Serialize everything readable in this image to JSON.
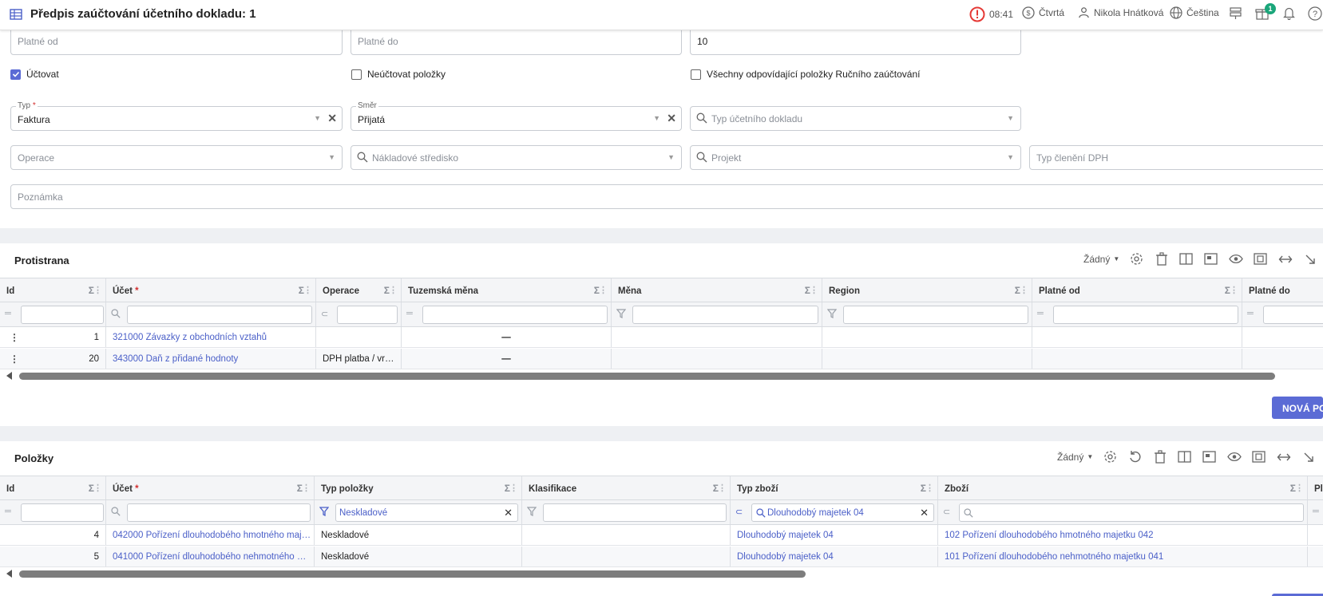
{
  "header": {
    "title": "Předpis zaúčtování účetního dokladu: 1",
    "time": "08:41",
    "day": "Čtvrtá",
    "user": "Nikola Hnátková",
    "language": "Čeština",
    "notification_count": "1"
  },
  "form": {
    "platne_od_placeholder": "Platné od",
    "platne_do_placeholder": "Platné do",
    "poradi_value": "10",
    "uctovat_label": "Účtovat",
    "uctovat_checked": true,
    "neuctovat_label": "Neúčtovat položky",
    "vsechny_label": "Všechny odpovídající položky Ručního zaúčtování",
    "typ_label": "Typ",
    "typ_value": "Faktura",
    "smer_label": "Směr",
    "smer_value": "Přijatá",
    "typ_dokladu_placeholder": "Typ účetního dokladu",
    "operace_placeholder": "Operace",
    "nakladove_placeholder": "Nákladové středisko",
    "projekt_placeholder": "Projekt",
    "typ_cleneni_placeholder": "Typ členění DPH",
    "poznamka_placeholder": "Poznámka"
  },
  "protistrana": {
    "title": "Protistrana",
    "view_label": "Žádný",
    "columns": [
      "Id",
      "Účet",
      "Operace",
      "Tuzemská měna",
      "Měna",
      "Region",
      "Platné od",
      "Platné do"
    ],
    "rows": [
      {
        "id": "1",
        "ucet": "321000 Závazky z obchodních vztahů",
        "operace": "",
        "tuzemska": "—"
      },
      {
        "id": "20",
        "ucet": "343000 Daň z přidané hodnoty",
        "operace": "DPH platba / vr…",
        "tuzemska": "—"
      }
    ],
    "new_button": "NOVÁ PO"
  },
  "polozky": {
    "title": "Položky",
    "view_label": "Žádný",
    "columns": [
      "Id",
      "Účet",
      "Typ položky",
      "Klasifikace",
      "Typ zboží",
      "Zboží",
      "Pl"
    ],
    "filter_typ_polozky": "Neskladové",
    "filter_typ_zbozi": "Dlouhodobý majetek 04",
    "rows": [
      {
        "id": "4",
        "ucet": "042000 Pořízení dlouhodobého hmotného maj…",
        "typ": "Neskladové",
        "typ_zbozi": "Dlouhodobý majetek 04",
        "zbozi": "102 Pořízení dlouhodobého hmotného majetku 042"
      },
      {
        "id": "5",
        "ucet": "041000 Pořízení dlouhodobého nehmotného …",
        "typ": "Neskladové",
        "typ_zbozi": "Dlouhodobý majetek 04",
        "zbozi": "101 Pořízení dlouhodobého nehmotného majetku 041"
      }
    ]
  },
  "colors": {
    "accent": "#5b6bd5",
    "link": "#4a5fc8",
    "alert": "#e53935",
    "badge": "#1aa67a"
  }
}
